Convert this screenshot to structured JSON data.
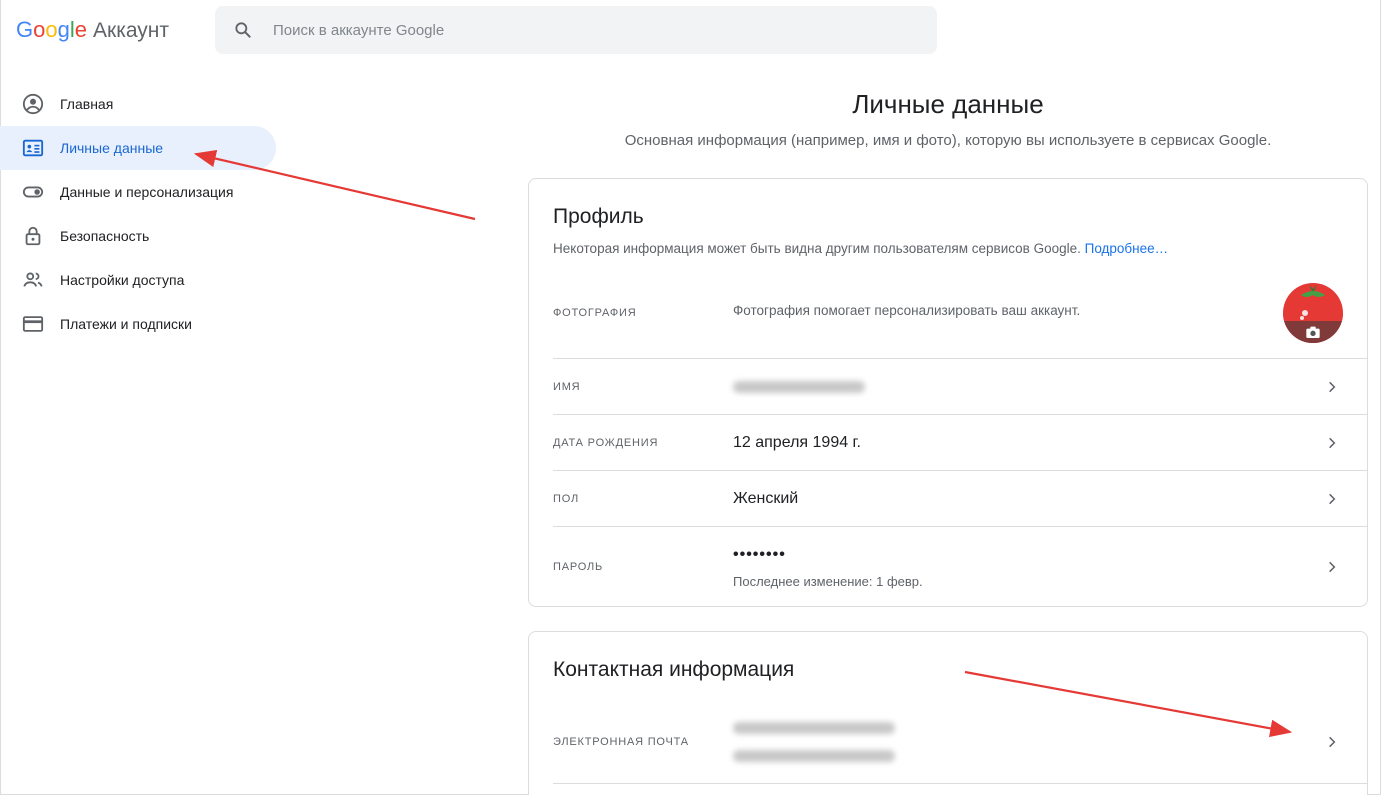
{
  "header": {
    "logo_word": [
      "G",
      "o",
      "o",
      "g",
      "l",
      "e"
    ],
    "product_name": "Аккаунт",
    "search_placeholder": "Поиск в аккаунте Google"
  },
  "sidebar": {
    "items": [
      {
        "label": "Главная",
        "icon": "account-circle-icon",
        "active": false
      },
      {
        "label": "Личные данные",
        "icon": "id-card-icon",
        "active": true
      },
      {
        "label": "Данные и персонализация",
        "icon": "toggle-icon",
        "active": false
      },
      {
        "label": "Безопасность",
        "icon": "lock-icon",
        "active": false
      },
      {
        "label": "Настройки доступа",
        "icon": "people-icon",
        "active": false
      },
      {
        "label": "Платежи и подписки",
        "icon": "credit-card-icon",
        "active": false
      }
    ]
  },
  "main": {
    "title": "Личные данные",
    "subtitle": "Основная информация (например, имя и фото), которую вы используете в сервисах Google."
  },
  "profile": {
    "title": "Профиль",
    "description": "Некоторая информация может быть видна другим пользователям сервисов Google.",
    "more_link": "Подробнее…",
    "photo": {
      "label": "Фотография",
      "value": "Фотография помогает персонализировать ваш аккаунт."
    },
    "name": {
      "label": "Имя"
    },
    "birthday": {
      "label": "Дата рождения",
      "value": "12 апреля 1994 г."
    },
    "gender": {
      "label": "Пол",
      "value": "Женский"
    },
    "password": {
      "label": "Пароль",
      "value": "••••••••",
      "note": "Последнее изменение: 1 февр."
    }
  },
  "contact": {
    "title": "Контактная информация",
    "email": {
      "label": "Электронная почта"
    }
  },
  "colors": {
    "accent": "#1a73e8",
    "active_bg": "#e8f0fe",
    "annotation_arrow": "#e53935"
  }
}
